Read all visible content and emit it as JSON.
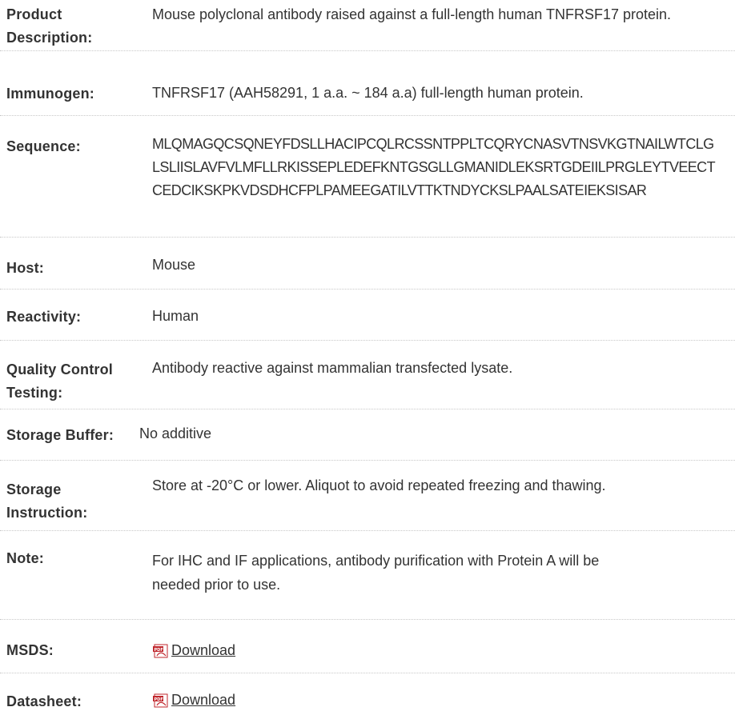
{
  "rows": [
    {
      "label": "Product Description:",
      "value": "Mouse polyclonal antibody raised against a full-length human TNFRSF17 protein."
    },
    {
      "label": "Immunogen:",
      "value": "TNFRSF17 (AAH58291, 1 a.a. ~ 184 a.a) full-length human protein."
    },
    {
      "label": "Sequence:",
      "value": "MLQMAGQCSQNEYFDSLLHACIPCQLRCSSNTPPLTCQRYCNASVTNSVKGTNAILWTCLGLSLIISLAVFVLMFLLRKISSEPLEDEFKNTGSGLLGMANIDLEKSRTGDEIILPRGLEYTVEECTCEDCIKSKPKVDSDHCFPLPAMEEGATILVTTKTNDYCKSLPAALSATEIEKSISAR"
    },
    {
      "label": "Host:",
      "value": "Mouse"
    },
    {
      "label": "Reactivity:",
      "value": "Human"
    },
    {
      "label": "Quality Control Testing:",
      "value": "Antibody reactive against mammalian transfected lysate."
    },
    {
      "label": "Storage Buffer:",
      "value": "No additive"
    },
    {
      "label": "Storage Instruction:",
      "value": "Store at -20°C or lower. Aliquot to avoid repeated freezing and thawing."
    },
    {
      "label": "Note:",
      "value": "For IHC and IF applications, antibody purification with Protein A will be needed prior to use."
    },
    {
      "label": "MSDS:",
      "link_text": "Download",
      "icon": "pdf-icon"
    },
    {
      "label": "Datasheet:",
      "link_text": "Download",
      "icon": "pdf-icon"
    }
  ],
  "colors": {
    "text": "#333333",
    "divider": "#c8c8c8",
    "pdf_icon": "#c0272d"
  }
}
